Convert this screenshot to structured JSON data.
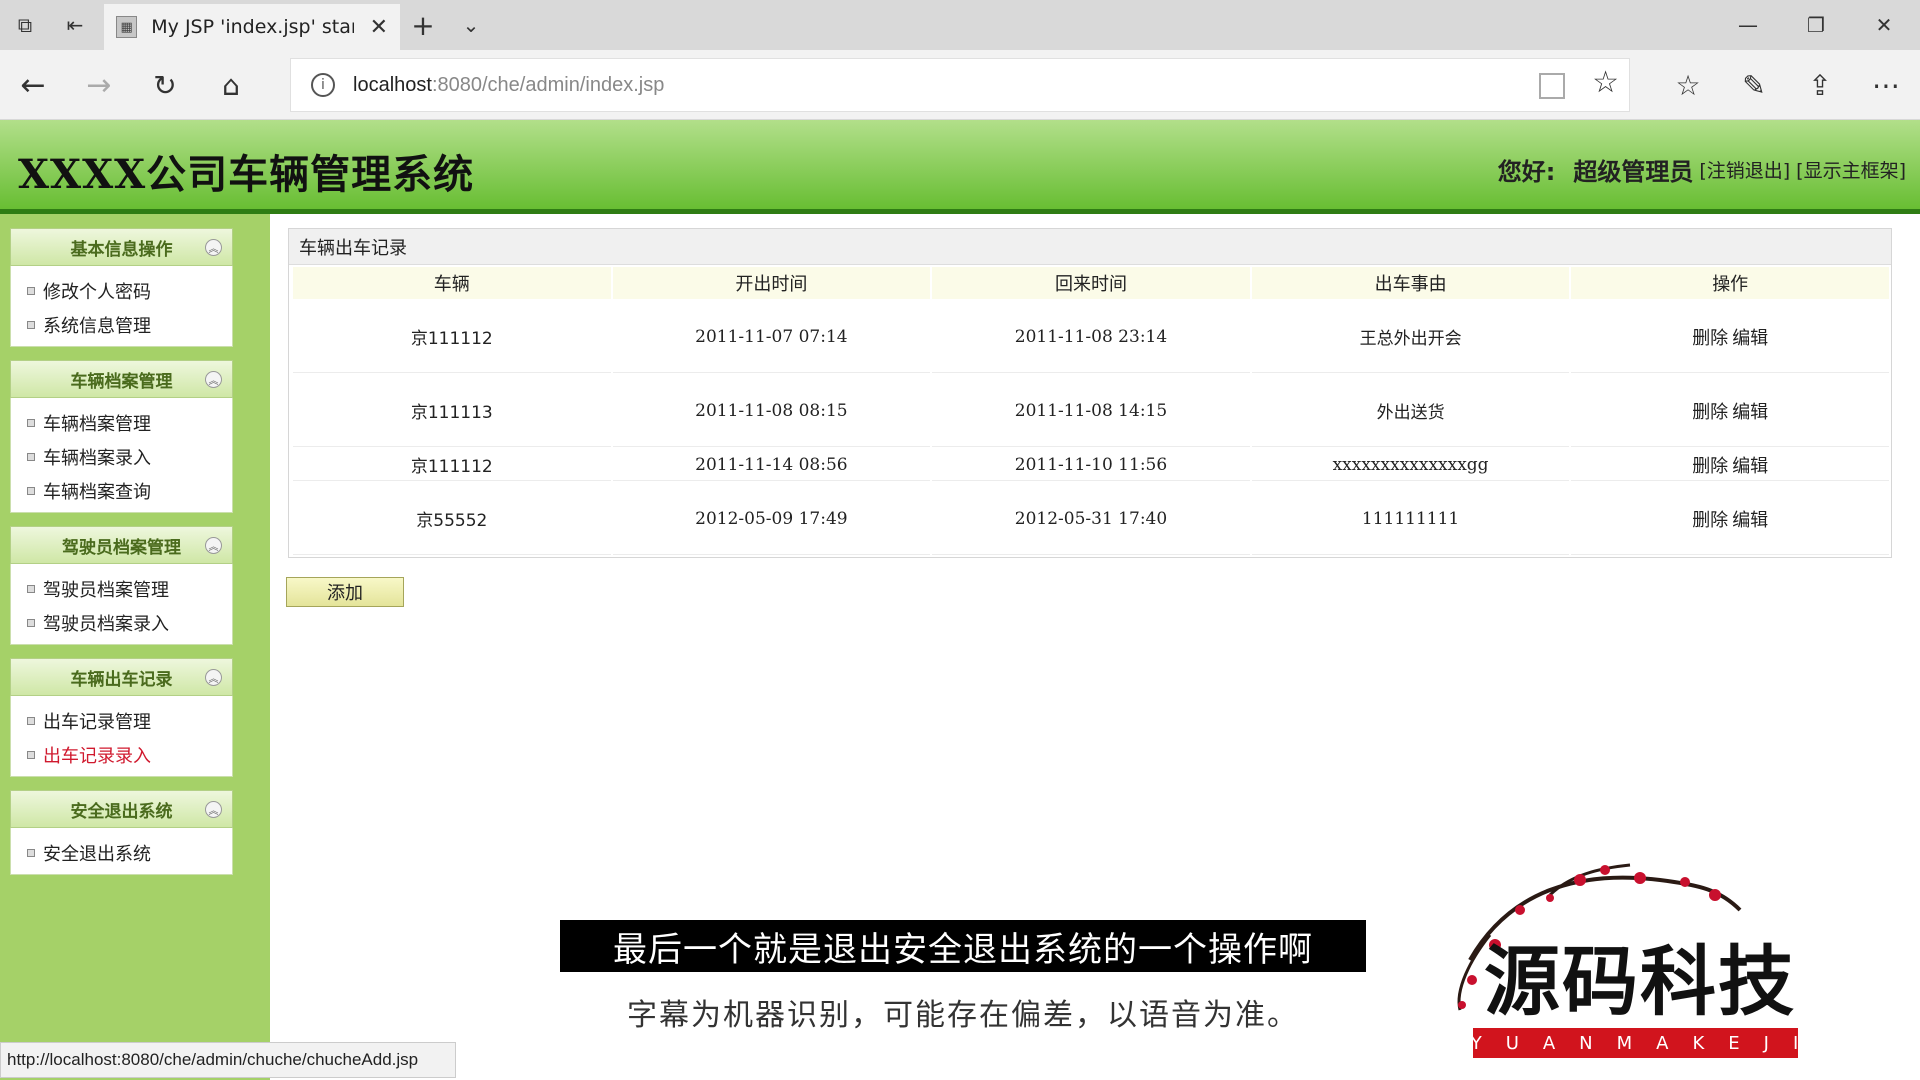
{
  "browser": {
    "tab_title": "My JSP 'index.jsp' startii",
    "url_host": "localhost",
    "url_path": ":8080/che/admin/index.jsp",
    "status_url": "http://localhost:8080/che/admin/chuche/chucheAdd.jsp"
  },
  "header": {
    "title": "XXXX公司车辆管理系统",
    "greeting": "您好:",
    "username": "超级管理员",
    "logout_link": "[注销退出]",
    "show_frame_link": "[显示主框架]"
  },
  "sidebar": {
    "groups": [
      {
        "title": "基本信息操作",
        "items": [
          "修改个人密码",
          "系统信息管理"
        ]
      },
      {
        "title": "车辆档案管理",
        "items": [
          "车辆档案管理",
          "车辆档案录入",
          "车辆档案查询"
        ]
      },
      {
        "title": "驾驶员档案管理",
        "items": [
          "驾驶员档案管理",
          "驾驶员档案录入"
        ]
      },
      {
        "title": "车辆出车记录",
        "items": [
          "出车记录管理",
          "出车记录录入"
        ]
      },
      {
        "title": "安全退出系统",
        "items": [
          "安全退出系统"
        ]
      }
    ]
  },
  "main": {
    "panel_title": "车辆出车记录",
    "columns": [
      "车辆",
      "开出时间",
      "回来时间",
      "出车事由",
      "操作"
    ],
    "rows": [
      {
        "vehicle": "京111112",
        "out_time": "2011-11-07 07:14",
        "back_time": "2011-11-08 23:14",
        "reason": "王总外出开会"
      },
      {
        "vehicle": "京111113",
        "out_time": "2011-11-08 08:15",
        "back_time": "2011-11-08 14:15",
        "reason": "外出送货"
      },
      {
        "vehicle": "京111112",
        "out_time": "2011-11-14 08:56",
        "back_time": "2011-11-10 11:56",
        "reason": "xxxxxxxxxxxxxxgg"
      },
      {
        "vehicle": "京55552",
        "out_time": "2012-05-09 17:49",
        "back_time": "2012-05-31 17:40",
        "reason": "111111111"
      }
    ],
    "delete_label": "删除",
    "edit_label": "编辑",
    "add_button": "添加"
  },
  "overlay": {
    "subtitle": "最后一个就是退出安全退出系统的一个操作啊",
    "subtitle_note": "字幕为机器识别，可能存在偏差，以语音为准。"
  }
}
